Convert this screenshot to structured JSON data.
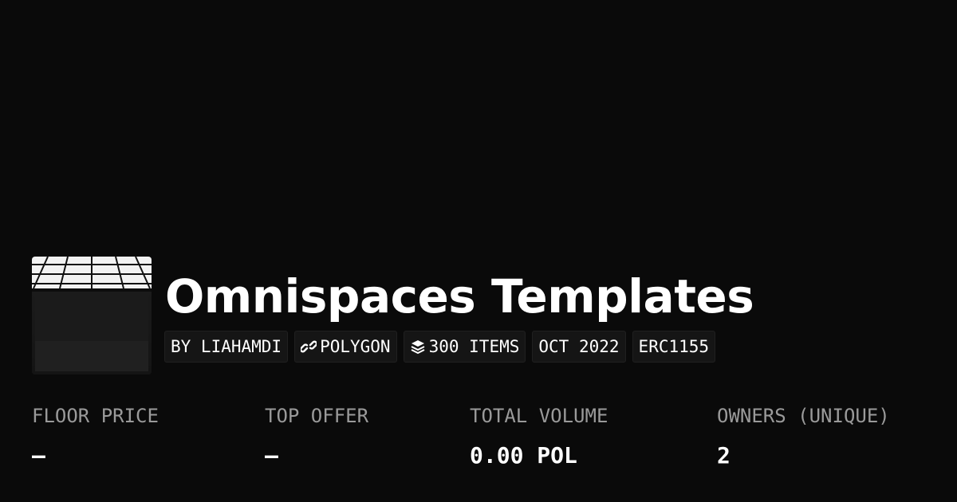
{
  "collection": {
    "title": "Omnispaces Templates",
    "thumbnail_icon": "ceiling-grid-room-image"
  },
  "chips": {
    "creator": "BY LIAHAMDI",
    "chain": "POLYGON",
    "chain_icon": "polygon-link-icon",
    "items": "300 ITEMS",
    "items_icon": "layers-icon",
    "date": "OCT 2022",
    "standard": "ERC1155"
  },
  "stats": {
    "floor_price": {
      "label": "FLOOR PRICE",
      "value": "–"
    },
    "top_offer": {
      "label": "TOP OFFER",
      "value": "–"
    },
    "total_volume": {
      "label": "TOTAL VOLUME",
      "value": "0.00 POL"
    },
    "owners": {
      "label": "OWNERS (UNIQUE)",
      "value": "2"
    }
  },
  "colors": {
    "background": "#0a0a0a",
    "chip_background": "#151515",
    "label_gray": "#9a9a9a",
    "text": "#ffffff"
  }
}
